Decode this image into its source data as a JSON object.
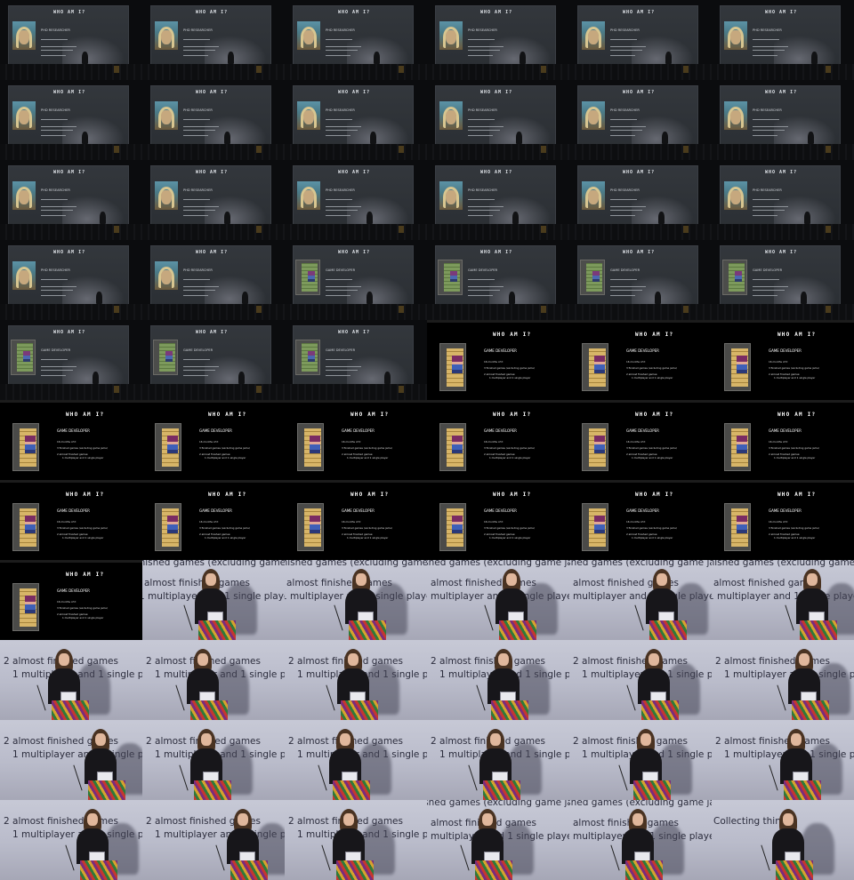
{
  "grid": {
    "columns": 6,
    "rows": 11
  },
  "slide_text": {
    "title": "WHO AM I?",
    "researcher_subtitle": "PHD RESEARCHER",
    "developer_subtitle": "GAME DEVELOPER",
    "dev_bullet_1": "16 months of it",
    "dev_bullet_2": "3 finished games (excluding game jams)",
    "dev_bullet_3": "2 almost finished games:",
    "dev_bullet_4": "1 multiplayer and 1 single player"
  },
  "stage_captions": {
    "line_a": "finished games (excluding game jams)",
    "line_b": "almost finished games",
    "line_c": "1 multiplayer and 1 single player",
    "line_d": "2 almost finished games",
    "line_e": "Collecting things"
  },
  "frames": [
    {
      "kind": "aud",
      "slide": "researcher"
    },
    {
      "kind": "aud",
      "slide": "researcher"
    },
    {
      "kind": "aud",
      "slide": "researcher"
    },
    {
      "kind": "aud",
      "slide": "researcher"
    },
    {
      "kind": "aud",
      "slide": "researcher"
    },
    {
      "kind": "aud",
      "slide": "researcher"
    },
    {
      "kind": "aud",
      "slide": "researcher"
    },
    {
      "kind": "aud",
      "slide": "researcher"
    },
    {
      "kind": "aud",
      "slide": "researcher"
    },
    {
      "kind": "aud",
      "slide": "researcher"
    },
    {
      "kind": "aud",
      "slide": "researcher"
    },
    {
      "kind": "aud",
      "slide": "researcher"
    },
    {
      "kind": "aud",
      "slide": "researcher"
    },
    {
      "kind": "aud",
      "slide": "researcher"
    },
    {
      "kind": "aud",
      "slide": "researcher"
    },
    {
      "kind": "aud",
      "slide": "researcher"
    },
    {
      "kind": "aud",
      "slide": "researcher"
    },
    {
      "kind": "aud",
      "slide": "researcher"
    },
    {
      "kind": "aud",
      "slide": "researcher"
    },
    {
      "kind": "aud",
      "slide": "researcher"
    },
    {
      "kind": "aud",
      "slide": "developer"
    },
    {
      "kind": "aud",
      "slide": "developer"
    },
    {
      "kind": "aud",
      "slide": "developer"
    },
    {
      "kind": "aud",
      "slide": "developer"
    },
    {
      "kind": "aud",
      "slide": "developer"
    },
    {
      "kind": "aud",
      "slide": "developer"
    },
    {
      "kind": "aud",
      "slide": "developer"
    },
    {
      "kind": "slide"
    },
    {
      "kind": "slide"
    },
    {
      "kind": "slide"
    },
    {
      "kind": "slide"
    },
    {
      "kind": "slide"
    },
    {
      "kind": "slide"
    },
    {
      "kind": "slide"
    },
    {
      "kind": "slide"
    },
    {
      "kind": "slide"
    },
    {
      "kind": "slide"
    },
    {
      "kind": "slide"
    },
    {
      "kind": "slide"
    },
    {
      "kind": "slide"
    },
    {
      "kind": "slide"
    },
    {
      "kind": "slide"
    },
    {
      "kind": "slide"
    },
    {
      "kind": "stage",
      "cap": "ab"
    },
    {
      "kind": "stage",
      "cap": "ab"
    },
    {
      "kind": "stage",
      "cap": "bc"
    },
    {
      "kind": "stage",
      "cap": "bc"
    },
    {
      "kind": "stage",
      "cap": "ab"
    },
    {
      "kind": "stage",
      "cap": "dc"
    },
    {
      "kind": "stage",
      "cap": "dc"
    },
    {
      "kind": "stage",
      "cap": "dc"
    },
    {
      "kind": "stage",
      "cap": "dc"
    },
    {
      "kind": "stage",
      "cap": "dc"
    },
    {
      "kind": "stage",
      "cap": "dc"
    },
    {
      "kind": "stage",
      "cap": "dc"
    },
    {
      "kind": "stage",
      "cap": "dc"
    },
    {
      "kind": "stage",
      "cap": "dc"
    },
    {
      "kind": "stage",
      "cap": "dc"
    },
    {
      "kind": "stage",
      "cap": "dc"
    },
    {
      "kind": "stage",
      "cap": "dc"
    },
    {
      "kind": "stage",
      "cap": "dc"
    },
    {
      "kind": "stage",
      "cap": "dc"
    },
    {
      "kind": "stage",
      "cap": "dc"
    },
    {
      "kind": "stage",
      "cap": "bc"
    },
    {
      "kind": "stage",
      "cap": "bc"
    },
    {
      "kind": "stage",
      "cap": "e"
    }
  ]
}
